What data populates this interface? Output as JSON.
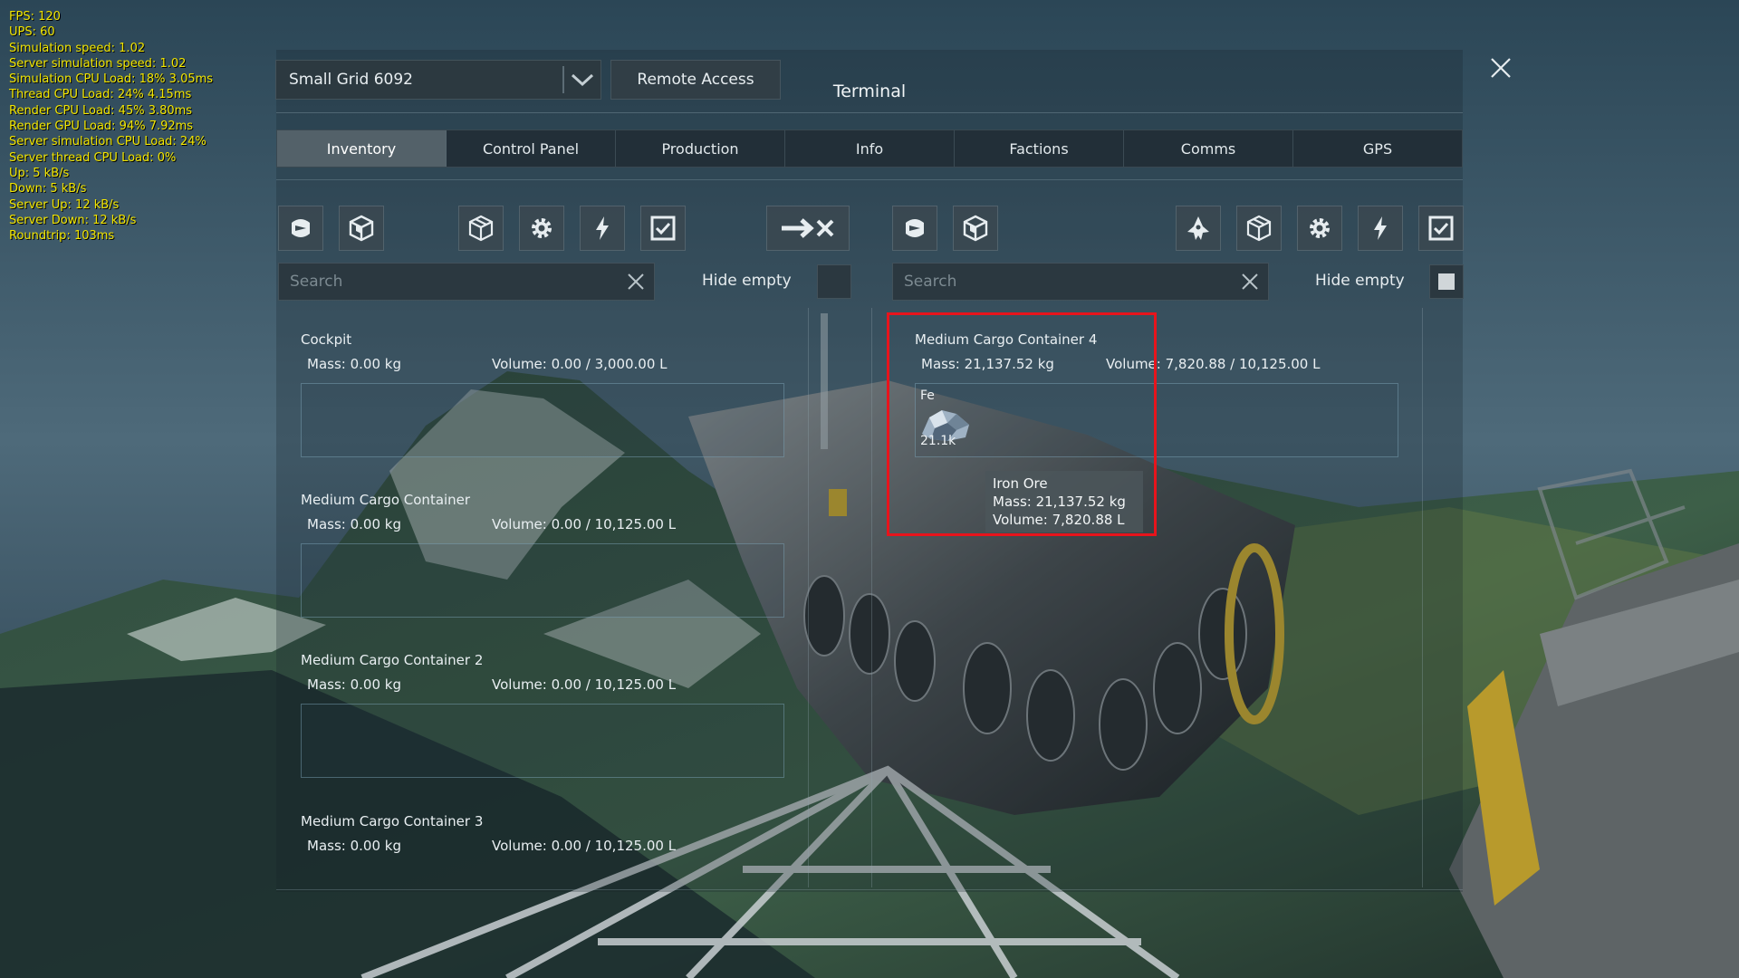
{
  "debug_lines": [
    "FPS: 120",
    "UPS: 60",
    "Simulation speed: 1.02",
    "Server simulation speed: 1.02",
    "Simulation CPU Load: 18% 3.05ms",
    "Thread CPU Load: 24% 4.15ms",
    "Render CPU Load: 45% 3.80ms",
    "Render GPU Load: 94% 7.92ms",
    "Server simulation CPU Load: 24%",
    "Server thread CPU Load: 0%",
    "Up: 5 kB/s",
    "Down: 5 kB/s",
    "Server Up: 12 kB/s",
    "Server Down: 12 kB/s",
    "Roundtrip: 103ms"
  ],
  "colors": {
    "debug_text": "#f2e600",
    "highlight": "#e8141c",
    "active_tab": "#5c6a72"
  },
  "header": {
    "grid_selector": "Small Grid 6092",
    "remote_access": "Remote Access",
    "title": "Terminal",
    "close_icon": "close-icon"
  },
  "tabs": [
    {
      "label": "Inventory",
      "active": true
    },
    {
      "label": "Control Panel",
      "active": false
    },
    {
      "label": "Production",
      "active": false
    },
    {
      "label": "Info",
      "active": false
    },
    {
      "label": "Factions",
      "active": false
    },
    {
      "label": "Comms",
      "active": false
    },
    {
      "label": "GPS",
      "active": false
    }
  ],
  "left_pane": {
    "search_placeholder": "Search",
    "hide_empty_label": "Hide empty",
    "hide_empty_checked": false,
    "toolbar_icons": [
      "character-icon",
      "grid-icon",
      "storage-icon",
      "gear-icon",
      "power-icon",
      "checkbox-icon"
    ],
    "inventories": [
      {
        "name": "Cockpit",
        "mass": "Mass: 0.00 kg",
        "volume": "Volume: 0.00 / 3,000.00 L"
      },
      {
        "name": "Medium Cargo Container",
        "mass": "Mass: 0.00 kg",
        "volume": "Volume: 0.00 / 10,125.00 L"
      },
      {
        "name": "Medium Cargo Container 2",
        "mass": "Mass: 0.00 kg",
        "volume": "Volume: 0.00 / 10,125.00 L"
      },
      {
        "name": "Medium Cargo Container 3",
        "mass": "Mass: 0.00 kg",
        "volume": "Volume: 0.00 / 10,125.00 L"
      }
    ]
  },
  "transfer_icon": "transfer-arrow-icon",
  "right_pane": {
    "search_placeholder": "Search",
    "hide_empty_label": "Hide empty",
    "hide_empty_checked": true,
    "toolbar_icons": [
      "character-icon",
      "grid-icon",
      "ship-icon",
      "storage-icon",
      "gear-icon",
      "power-icon",
      "checkbox-icon"
    ],
    "inventories": [
      {
        "name": "Medium Cargo Container 4",
        "mass": "Mass: 21,137.52 kg",
        "volume": "Volume: 7,820.88 / 10,125.00 L",
        "items": [
          {
            "symbol": "Fe",
            "amount": "21.1k",
            "icon": "iron-ore-icon"
          }
        ]
      }
    ]
  },
  "tooltip": {
    "name": "Iron Ore",
    "mass": "Mass: 21,137.52 kg",
    "volume": "Volume: 7,820.88 L"
  }
}
